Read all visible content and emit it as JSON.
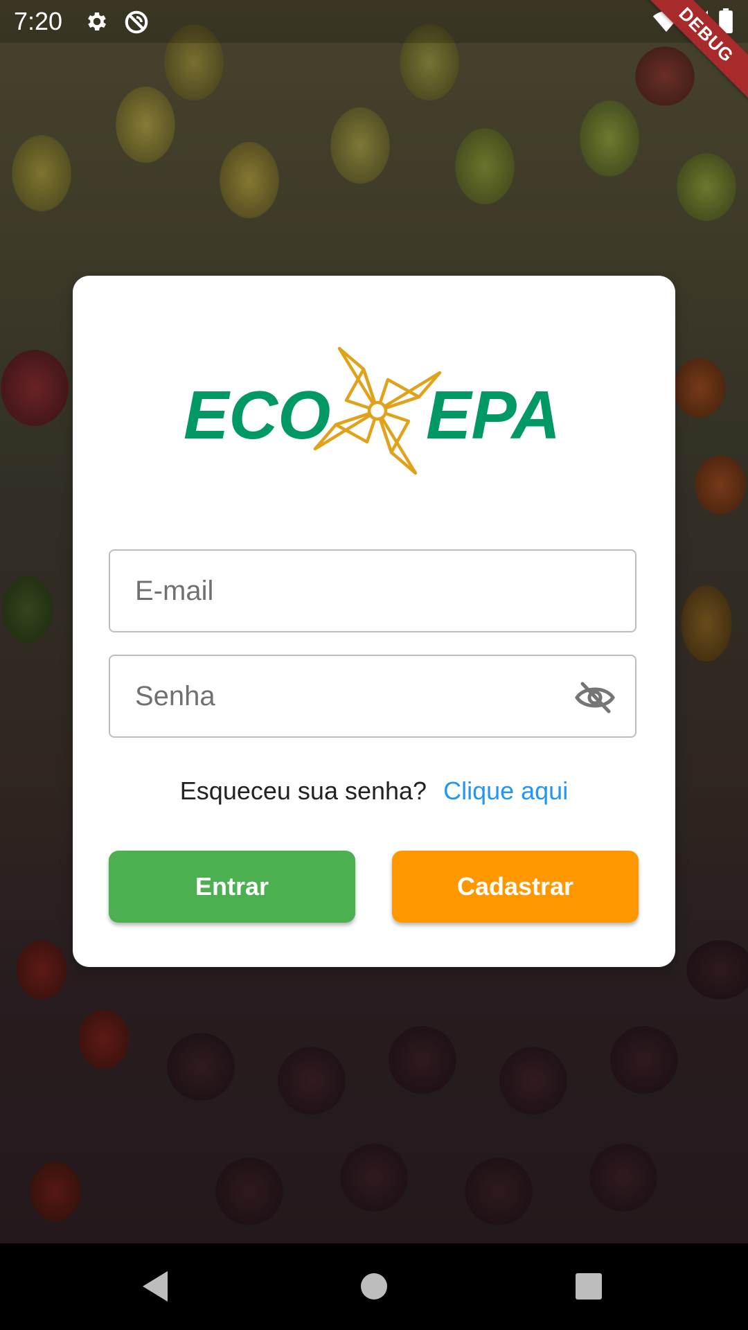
{
  "status_bar": {
    "time": "7:20",
    "icons": [
      "gear-icon",
      "sync-disabled-icon",
      "wifi-icon",
      "signal-icon",
      "battery-icon"
    ]
  },
  "debug_banner": "DEBUG",
  "logo": {
    "left_text": "ECO",
    "right_text": "EPA",
    "icon": "pinwheel-icon",
    "colors": {
      "text": "#009966",
      "pinwheel": "#E0A21B"
    }
  },
  "form": {
    "email_placeholder": "E-mail",
    "password_placeholder": "Senha",
    "password_toggle_icon": "eye-off-icon"
  },
  "forgot": {
    "text": "Esqueceu sua senha?",
    "link": "Clique aqui"
  },
  "buttons": {
    "login": "Entrar",
    "register": "Cadastrar"
  },
  "colors": {
    "login_button": "#4CAF50",
    "register_button": "#FF9800",
    "link": "#2196F3"
  },
  "nav": {
    "back": "back-triangle-icon",
    "home": "home-circle-icon",
    "recents": "recents-square-icon"
  }
}
